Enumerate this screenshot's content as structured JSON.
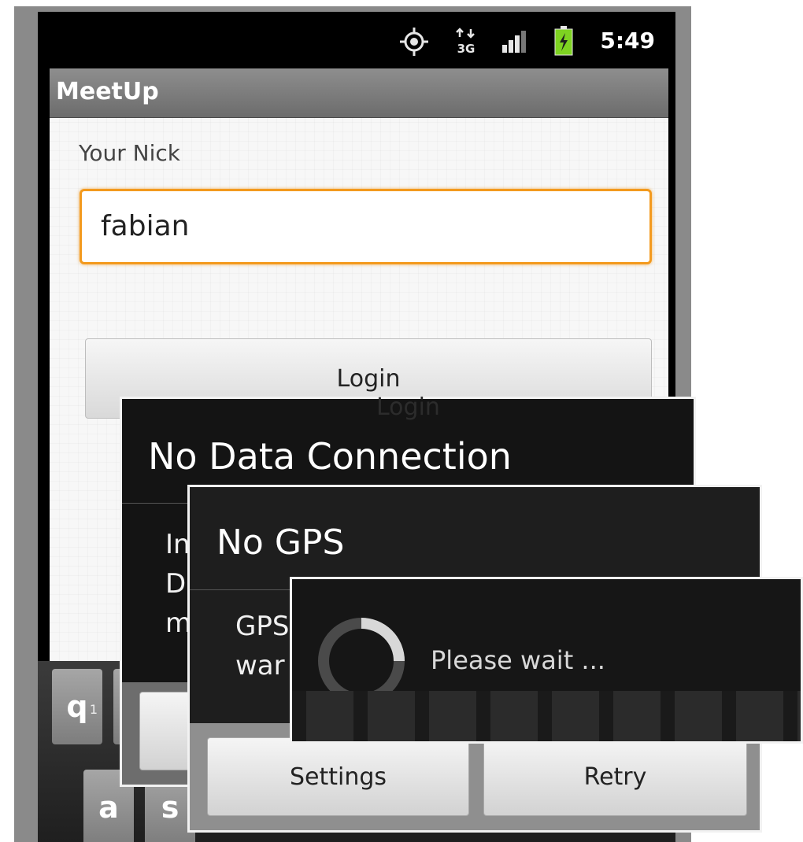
{
  "status_bar": {
    "time": "5:49",
    "network_label": "3G",
    "icons": [
      "gps-icon",
      "network-3g-icon",
      "signal-icon",
      "battery-charging-icon"
    ]
  },
  "app": {
    "title": "MeetUp",
    "nick_label": "Your Nick",
    "nick_value": "fabian",
    "login_label": "Login",
    "login_ghost": "Login"
  },
  "keyboard": {
    "keys": [
      {
        "label": "q",
        "sub": "1"
      },
      {
        "label": "a",
        "sub": ""
      },
      {
        "label": "s",
        "sub": ""
      }
    ]
  },
  "dialogs": {
    "no_data": {
      "title": "No Data Connection",
      "body_partial": "In\nD\nm"
    },
    "no_gps": {
      "title": "No GPS",
      "body_partial": "GPS\nwar",
      "settings_label": "Settings",
      "retry_label": "Retry"
    },
    "progress": {
      "message": "Please wait ..."
    }
  },
  "colors": {
    "accent_orange": "#f39a1e",
    "dialog_bg": "#1e1e1e",
    "battery_green": "#7ed321"
  }
}
